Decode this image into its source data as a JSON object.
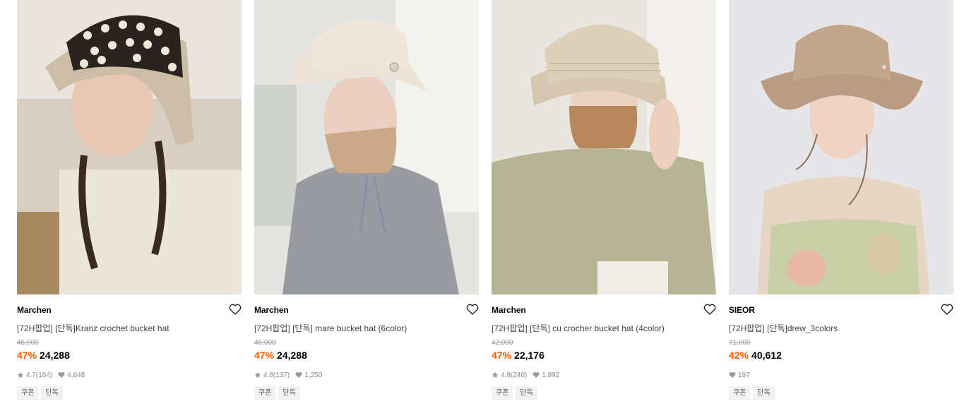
{
  "products": [
    {
      "brand": "Marchen",
      "name": "[72H팝업] [단독]Kranz crochet bucket hat",
      "original_price": "46,000",
      "discount": "47%",
      "price": "24,288",
      "rating": "4.7",
      "reviews": "(164)",
      "likes": "4,648",
      "tags": [
        "쿠폰",
        "단독"
      ],
      "image": "model-crochet-hat-photo"
    },
    {
      "brand": "Marchen",
      "name": "[72H팝업] [단독] mare bucket hat (6color)",
      "original_price": "46,000",
      "discount": "47%",
      "price": "24,288",
      "rating": "4.8",
      "reviews": "(137)",
      "likes": "1,250",
      "tags": [
        "쿠폰",
        "단독"
      ],
      "image": "model-bucket-hat-photo"
    },
    {
      "brand": "Marchen",
      "name": "[72H팝업] [단독] cu crocher bucket hat (4color)",
      "original_price": "42,000",
      "discount": "47%",
      "price": "22,176",
      "rating": "4.9",
      "reviews": "(240)",
      "likes": "1,992",
      "tags": [
        "쿠폰",
        "단독"
      ],
      "image": "model-crochet-hat-photo"
    },
    {
      "brand": "SIEOR",
      "name": "[72H팝업] [단독]drew_3colors",
      "original_price": "71,000",
      "discount": "42%",
      "price": "40,612",
      "rating": "",
      "reviews": "",
      "likes": "197",
      "tags": [
        "쿠폰",
        "단독"
      ],
      "image": "model-wide-brim-hat-photo"
    }
  ],
  "colors": {
    "discount": "#ff5a00",
    "tag_bg": "#f2f2f2",
    "muted": "#888888"
  },
  "icons": {
    "wishlist": "heart-outline-icon",
    "rating": "star-icon",
    "likes": "heart-filled-icon"
  }
}
